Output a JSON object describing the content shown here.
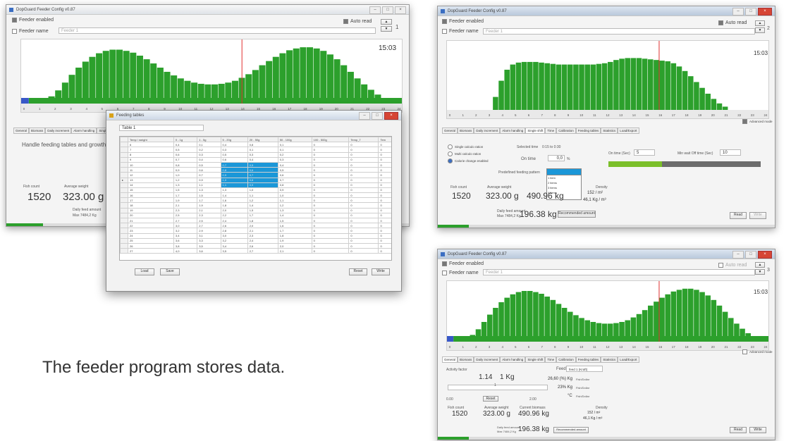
{
  "app_title": "DopGuard Feeder Config v0.87",
  "feeder_enabled_label": "Feeder enabled",
  "feeder_name_label": "Feeder name",
  "feeder_name_placeholder": "Feeder 1",
  "auto_read_label": "Auto read",
  "feeder_numbers": [
    "1",
    "2",
    "3"
  ],
  "clock": "15:03",
  "axis_ticks": [
    "0",
    "1",
    "2",
    "3",
    "4",
    "5",
    "6",
    "7",
    "8",
    "9",
    "10",
    "11",
    "12",
    "13",
    "14",
    "15",
    "16",
    "17",
    "18",
    "19",
    "20",
    "21",
    "22",
    "23",
    "24"
  ],
  "tabs": [
    "General",
    "Biomass",
    "Daily increment",
    "Alarm handling",
    "Single shift",
    "Time",
    "Calibration",
    "Feeding tables",
    "Statistics",
    "Load/Export"
  ],
  "advanced_mode_label": "Advanced mode",
  "handle_text": "Handle feeding tables and growth tab",
  "fish_count_label": "Fish count",
  "fish_count": "1520",
  "average_weight_label": "Average weight",
  "average_weight": "323.00 g",
  "current_biomass_label": "Current biomass",
  "current_biomass": "490.96 kg",
  "density_label": "Density",
  "density_m2": "152 / m²",
  "density_kg": "46,1 Kg / m³",
  "daily_feed_label": "Daily feed amount",
  "daily_feed_max": "Max 7484,2 Kg",
  "daily_feed": "196.38 kg",
  "recommended_label": "Recommended amount",
  "read_button": "Read",
  "write_button": "Write",
  "dialog": {
    "title": "Feeding tables",
    "name_value": "Table 1",
    "headers": [
      "Temp \\ weight",
      "0 - 1g",
      "1 - 5g",
      "5 - 20g",
      "20 - 50g",
      "50 - 100g",
      "100 - 500g",
      "Temp_7",
      "Tem"
    ],
    "rows": [
      [
        "6",
        "0,4",
        "0,1",
        "0,4",
        "0,8",
        "0,1",
        "0",
        "0"
      ],
      [
        "7",
        "0,5",
        "0,2",
        "0,3",
        "0,1",
        "0,1",
        "0",
        "0"
      ],
      [
        "8",
        "0,6",
        "0,3",
        "0,5",
        "0,3",
        "0,2",
        "0",
        "0"
      ],
      [
        "9",
        "0,7",
        "0,4",
        "0,6",
        "0,4",
        "0,3",
        "0",
        "0"
      ],
      [
        "10",
        "0,8",
        "0,5",
        "0,7",
        "0,5",
        "0,4",
        "0",
        "0"
      ],
      [
        "11",
        "0,9",
        "0,6",
        "0,8",
        "0,6",
        "0,5",
        "0",
        "0"
      ],
      [
        "12",
        "1,0",
        "0,7",
        "0,9",
        "0,7",
        "0,6",
        "0",
        "0"
      ],
      [
        "13",
        "1,2",
        "0,9",
        "1,0",
        "0,8",
        "0,7",
        "0",
        "0"
      ],
      [
        "14",
        "1,3",
        "1,1",
        "1,1",
        "0,9",
        "0,8",
        "0",
        "0"
      ],
      [
        "15",
        "1,5",
        "1,3",
        "1,3",
        "1,0",
        "0,9",
        "0",
        "0"
      ],
      [
        "16",
        "1,7",
        "1,5",
        "1,4",
        "1,1",
        "1,0",
        "0",
        "0"
      ],
      [
        "17",
        "1,9",
        "1,7",
        "1,6",
        "1,2",
        "1,1",
        "0",
        "0"
      ],
      [
        "18",
        "2,1",
        "1,9",
        "1,8",
        "1,4",
        "1,2",
        "0",
        "0"
      ],
      [
        "19",
        "2,3",
        "2,1",
        "2,0",
        "1,5",
        "1,3",
        "0",
        "0"
      ],
      [
        "20",
        "2,5",
        "2,3",
        "2,2",
        "1,7",
        "1,4",
        "0",
        "0"
      ],
      [
        "21",
        "2,7",
        "2,5",
        "2,4",
        "1,8",
        "1,5",
        "0",
        "0"
      ],
      [
        "22",
        "3,0",
        "2,7",
        "2,6",
        "2,0",
        "1,6",
        "0",
        "0"
      ],
      [
        "23",
        "3,2",
        "2,9",
        "2,8",
        "2,1",
        "1,7",
        "0",
        "0"
      ],
      [
        "24",
        "3,4",
        "3,1",
        "3,0",
        "2,3",
        "1,8",
        "0",
        "0"
      ],
      [
        "25",
        "3,6",
        "3,3",
        "3,2",
        "2,4",
        "1,9",
        "0",
        "0"
      ],
      [
        "26",
        "3,8",
        "3,5",
        "3,4",
        "2,6",
        "2,0",
        "0",
        "0"
      ],
      [
        "27",
        "4,0",
        "3,6",
        "3,5",
        "2,7",
        "2,1",
        "0",
        "0"
      ]
    ],
    "load_button": "Load",
    "save_button": "Save",
    "reset_button": "Reset",
    "write_button": "Write"
  },
  "single_shift": {
    "options": [
      "Single calculo ration",
      "Multi calculo ration",
      "Calorie change enabled"
    ],
    "selected_time_label": "Selected time",
    "selected_time": "0:15 to 0:30",
    "on_time_label": "On time",
    "on_time": "0,0",
    "on_time_unit": "%",
    "on_time_sec_label": "On time (Sec)",
    "on_time_sec": "5",
    "min_wait_label": "Min wait Off time (Sec)",
    "min_wait": "10",
    "predefined_label": "Predefined feeding pattern",
    "dropdown_options": [
      "1 item",
      "2 items",
      "3 items",
      "4 items"
    ],
    "level_fraction": 0.35
  },
  "general": {
    "activity_label": "Activity factor",
    "activity_value": "1.14",
    "activity_unit": "1 Kg",
    "slider_value": "1",
    "slider_min": "0.00",
    "slider_max": "2.00",
    "slider_button": "Reset",
    "feed_label": "Feed",
    "feed_value": "feed 1 (Kraft)",
    "protein": "26,60 (%) Kg",
    "protein_label": "Fish/Dollar",
    "fat": "23% Kg",
    "fat_label": "Fish/Dollar",
    "temp": "°C",
    "temp_label": "Fish/Dollar"
  },
  "curve_profile": [
    0,
    0,
    0,
    0.05,
    0.12,
    0.22,
    0.35,
    0.48,
    0.6,
    0.7,
    0.78,
    0.84,
    0.88,
    0.9,
    0.9,
    0.88,
    0.85,
    0.8,
    0.74,
    0.67,
    0.6,
    0.53,
    0.47,
    0.42,
    0.38,
    0.35,
    0.33,
    0.32,
    0.32,
    0.33,
    0.35,
    0.38,
    0.43,
    0.49,
    0.56,
    0.64,
    0.71,
    0.78,
    0.84,
    0.89,
    0.92,
    0.94,
    0.94,
    0.92,
    0.88,
    0.82,
    0.74,
    0.64,
    0.53,
    0.42,
    0.32,
    0.23,
    0.15,
    0.09,
    0.05,
    0.02
  ],
  "plateau_profile": [
    0,
    0,
    0,
    0,
    0,
    0,
    0,
    0,
    0.2,
    0.45,
    0.62,
    0.7,
    0.73,
    0.74,
    0.74,
    0.74,
    0.73,
    0.72,
    0.71,
    0.7,
    0.7,
    0.7,
    0.7,
    0.7,
    0.7,
    0.7,
    0.71,
    0.72,
    0.74,
    0.77,
    0.79,
    0.8,
    0.8,
    0.8,
    0.79,
    0.78,
    0.77,
    0.76,
    0.75,
    0.72,
    0.67,
    0.6,
    0.52,
    0.43,
    0.34,
    0.25,
    0.17,
    0.1,
    0.05,
    0,
    0,
    0,
    0,
    0,
    0,
    0
  ],
  "caption": "The feeder program stores data.",
  "colors": {
    "bar_green": "#2ca02c",
    "bar_dark": "#1e7e1e",
    "marker": "#e03030",
    "selection": "#1b97d8"
  }
}
